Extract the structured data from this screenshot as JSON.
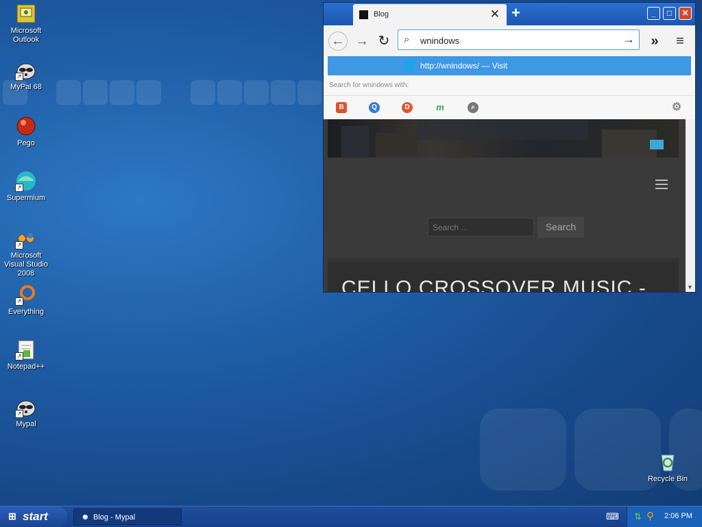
{
  "desktop": {
    "icons": [
      {
        "label": "Microsoft Outlook",
        "icon": "outlook-icon"
      },
      {
        "label": "MyPal 68",
        "icon": "raccoon-icon"
      },
      {
        "label": "Pego",
        "icon": "pego-icon"
      },
      {
        "label": "Supermium",
        "icon": "supermium-icon"
      },
      {
        "label": "Microsoft Visual Studio 2008",
        "icon": "visual-studio-icon"
      },
      {
        "label": "Everything",
        "icon": "everything-icon"
      },
      {
        "label": "Notepad++",
        "icon": "notepad-icon"
      },
      {
        "label": "Mypal",
        "icon": "raccoon-icon"
      },
      {
        "label": "Recycle Bin",
        "icon": "recycle-bin-icon"
      }
    ]
  },
  "browser": {
    "tab_title": "Blog",
    "url_value": "wnindows",
    "suggestion": {
      "text": "http://wnindows/ — Visit"
    },
    "search_for": "Search for wnindows with:",
    "page": {
      "search_placeholder": "Search ...",
      "search_button": "Search",
      "post_title": "CELLO CROSSOVER MUSIC -"
    }
  },
  "taskbar": {
    "start_label": "start",
    "task_label": "Blog - Mypal",
    "clock": "2:06 PM"
  },
  "colors": {
    "suggestion_highlight": "#3e98e4",
    "titlebar": "#1c57b0",
    "taskbar": "#17408a"
  }
}
